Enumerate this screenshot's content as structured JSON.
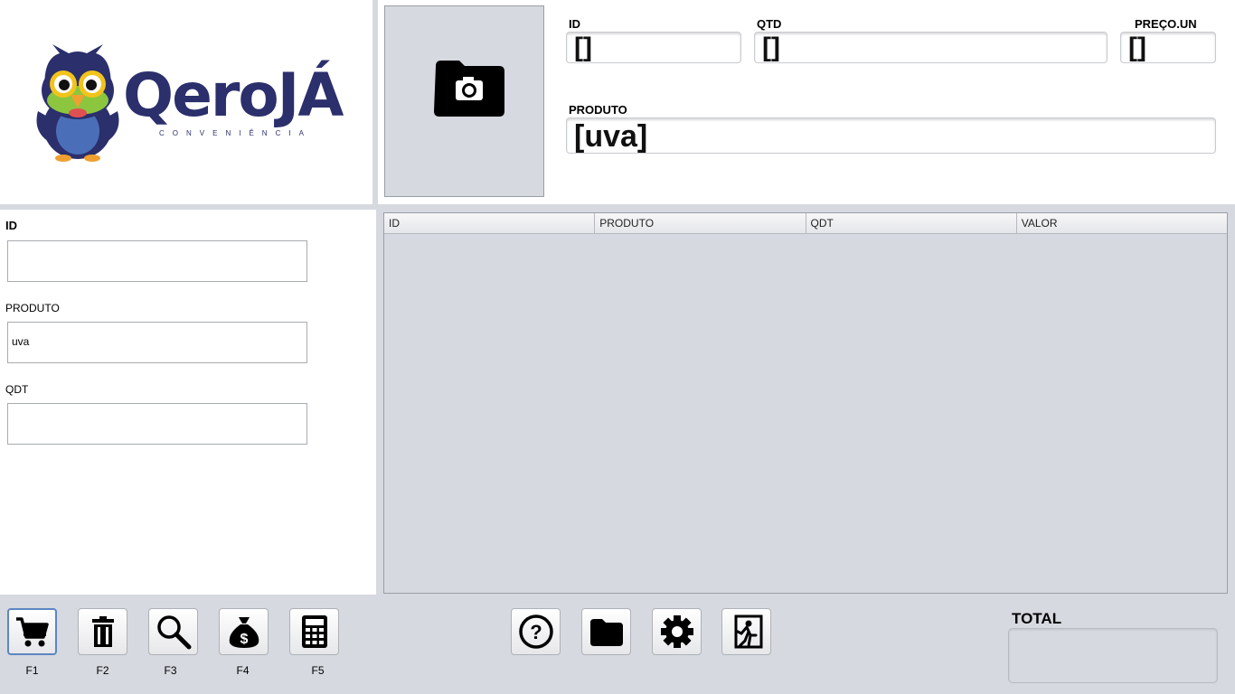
{
  "brand": {
    "name": "QeroJÁ",
    "tagline": "CONVENIÊNCIA"
  },
  "product_display": {
    "id_label": "ID",
    "id_value": "[]",
    "qtd_label": "QTD",
    "qtd_value": "[]",
    "preco_label": "PREÇO.UN",
    "preco_value": "[]",
    "produto_label": "PRODUTO",
    "produto_value": "[uva]"
  },
  "form": {
    "id_label": "ID",
    "id_value": "",
    "produto_label": "PRODUTO",
    "produto_value": "uva",
    "qdt_label": "QDT",
    "qdt_value": ""
  },
  "table": {
    "columns": [
      "ID",
      "PRODUTO",
      "QDT",
      "VALOR"
    ],
    "rows": []
  },
  "toolbar_left": [
    {
      "icon": "cart-icon",
      "key": "F1"
    },
    {
      "icon": "trash-icon",
      "key": "F2"
    },
    {
      "icon": "search-icon",
      "key": "F3"
    },
    {
      "icon": "money-bag-icon",
      "key": "F4"
    },
    {
      "icon": "calculator-icon",
      "key": "F5"
    }
  ],
  "toolbar_right": [
    {
      "icon": "help-icon"
    },
    {
      "icon": "folder-icon"
    },
    {
      "icon": "gear-icon"
    },
    {
      "icon": "exit-icon"
    }
  ],
  "total": {
    "label": "TOTAL",
    "value": ""
  },
  "colors": {
    "brand_navy": "#2b2f6b",
    "owl_green": "#8cc63f",
    "owl_orange": "#f0a030",
    "panel_bg": "#d6d9df"
  }
}
